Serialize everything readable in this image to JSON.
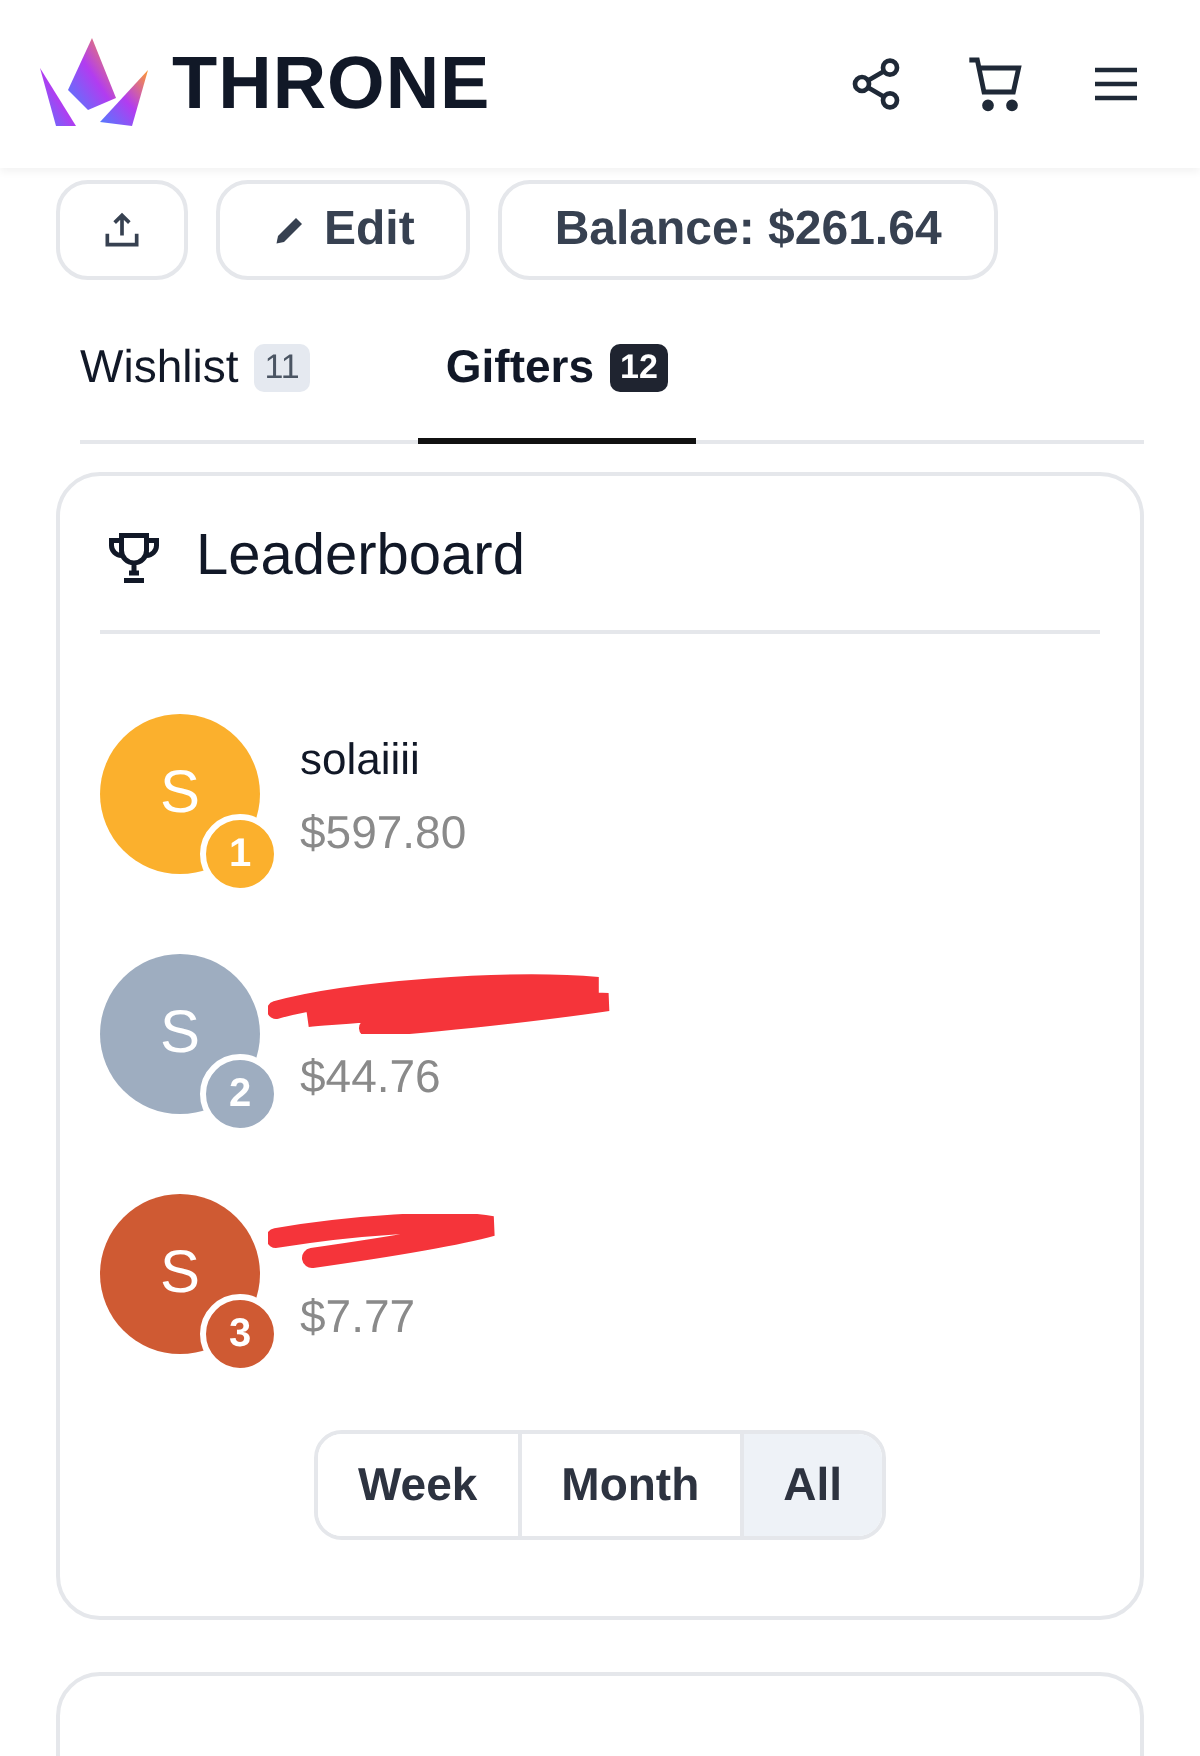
{
  "header": {
    "brand": "THRONE"
  },
  "actions": {
    "edit": "Edit",
    "balance": "Balance: $261.64"
  },
  "tabs": [
    {
      "label": "Wishlist",
      "count": "11",
      "selected": false
    },
    {
      "label": "Gifters",
      "count": "12",
      "selected": true
    }
  ],
  "leaderboard": {
    "title": "Leaderboard",
    "gifters": [
      {
        "initial": "S",
        "rank": "1",
        "color": "#fbb02d",
        "name": "solaiiii",
        "amount": "$597.80",
        "redacted": false
      },
      {
        "initial": "S",
        "rank": "2",
        "color": "#9eadc0",
        "amount": "$44.76",
        "redacted": true
      },
      {
        "initial": "S",
        "rank": "3",
        "color": "#cf5a33",
        "amount": "$7.77",
        "redacted": true
      }
    ],
    "periods": [
      {
        "label": "Week",
        "selected": false
      },
      {
        "label": "Month",
        "selected": false
      },
      {
        "label": "All",
        "selected": true
      }
    ]
  }
}
